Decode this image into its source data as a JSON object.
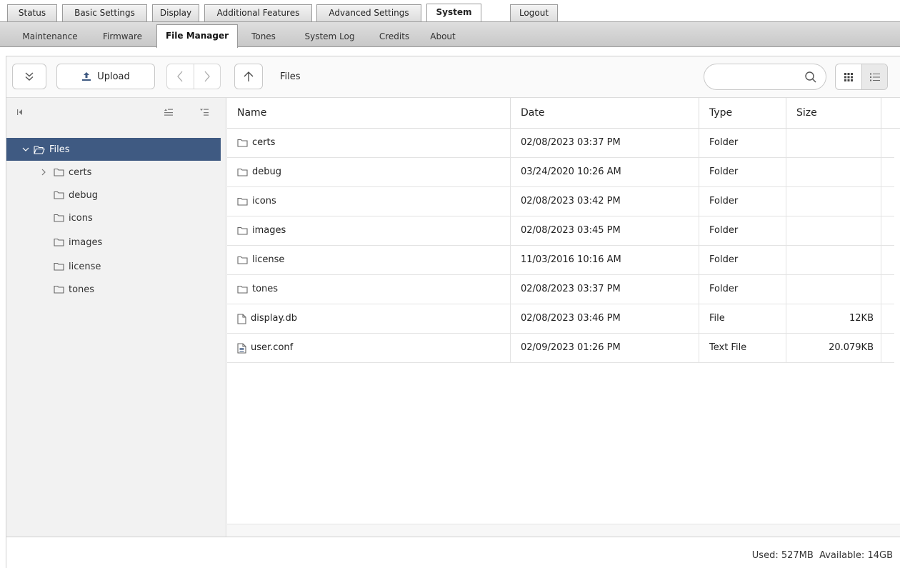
{
  "top_tabs": [
    {
      "label": "Status",
      "active": false
    },
    {
      "label": "Basic Settings",
      "active": false
    },
    {
      "label": "Display",
      "active": false
    },
    {
      "label": "Additional Features",
      "active": false
    },
    {
      "label": "Advanced Settings",
      "active": false
    },
    {
      "label": "System",
      "active": true
    },
    {
      "label": "Logout",
      "active": false
    }
  ],
  "sub_tabs": [
    {
      "label": "Maintenance",
      "active": false
    },
    {
      "label": "Firmware",
      "active": false
    },
    {
      "label": "File Manager",
      "active": true
    },
    {
      "label": "Tones",
      "active": false
    },
    {
      "label": "System Log",
      "active": false
    },
    {
      "label": "Credits",
      "active": false
    },
    {
      "label": "About",
      "active": false
    }
  ],
  "toolbar": {
    "upload_label": "Upload",
    "breadcrumb": "Files",
    "search_placeholder": "",
    "search_value": ""
  },
  "tree": {
    "root": {
      "label": "Files",
      "expanded": true,
      "selected": true
    },
    "items": [
      {
        "label": "certs",
        "has_children": true
      },
      {
        "label": "debug",
        "has_children": false
      },
      {
        "label": "icons",
        "has_children": false
      },
      {
        "label": "images",
        "has_children": false
      },
      {
        "label": "license",
        "has_children": false
      },
      {
        "label": "tones",
        "has_children": false
      }
    ]
  },
  "list": {
    "columns": [
      "Name",
      "Date",
      "Type",
      "Size"
    ],
    "rows": [
      {
        "name": "certs",
        "date": "02/08/2023 03:37 PM",
        "type": "Folder",
        "size": "",
        "icon": "folder-icon"
      },
      {
        "name": "debug",
        "date": "03/24/2020 10:26 AM",
        "type": "Folder",
        "size": "",
        "icon": "folder-icon"
      },
      {
        "name": "icons",
        "date": "02/08/2023 03:42 PM",
        "type": "Folder",
        "size": "",
        "icon": "folder-icon"
      },
      {
        "name": "images",
        "date": "02/08/2023 03:45 PM",
        "type": "Folder",
        "size": "",
        "icon": "folder-icon"
      },
      {
        "name": "license",
        "date": "11/03/2016 10:16 AM",
        "type": "Folder",
        "size": "",
        "icon": "folder-icon"
      },
      {
        "name": "tones",
        "date": "02/08/2023 03:37 PM",
        "type": "Folder",
        "size": "",
        "icon": "folder-icon"
      },
      {
        "name": "display.db",
        "date": "02/08/2023 03:46 PM",
        "type": "File",
        "size": "12KB",
        "icon": "file-icon"
      },
      {
        "name": "user.conf",
        "date": "02/09/2023 01:26 PM",
        "type": "Text File",
        "size": "20.079KB",
        "icon": "text-file-icon"
      }
    ]
  },
  "status": {
    "used_label": "Used:",
    "used_value": "527MB",
    "available_label": "Available:",
    "available_value": "14GB"
  },
  "colors": {
    "tree_selected_bg": "#3f5a82",
    "accent_upload": "#3f5a82"
  }
}
